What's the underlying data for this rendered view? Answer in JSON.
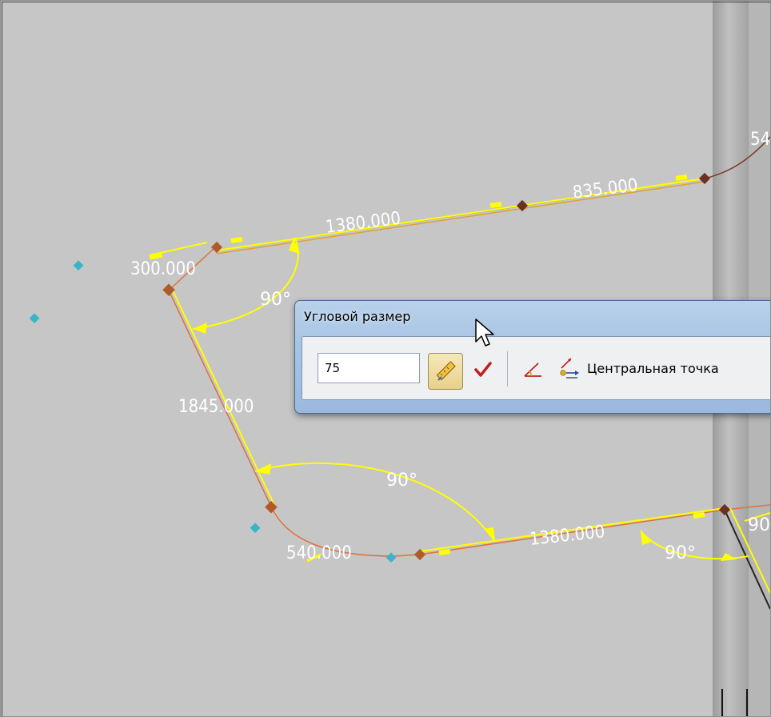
{
  "drawing": {
    "dimensions": {
      "d_300": "300.000",
      "d_1380_top": "1380.000",
      "d_835": "835.000",
      "d_1845": "1845.000",
      "d_540": "540.000",
      "d_1380_bottom": "1380.000",
      "d_edge_top": "54",
      "angle_top": "90°",
      "angle_mid": "90°",
      "angle_bottom_right": "90°",
      "angle_edge": "90"
    }
  },
  "dialog": {
    "title": "Угловой размер",
    "input_value": "75",
    "center_point_label": "Центральная точка"
  },
  "icons": {
    "measure": "ruler-icon",
    "apply": "checkmark-icon",
    "angle_type": "angle-icon",
    "center_point": "center-point-icon"
  },
  "colors": {
    "background": "#c6c6c6",
    "dimension_line": "#ffff00",
    "sketch_curve": "#e0703a",
    "point_marker": "#b05a2a",
    "teal_marker": "#3ab5c8",
    "dialog_frame": "#a7c4e4",
    "apply_check": "#c02020"
  }
}
